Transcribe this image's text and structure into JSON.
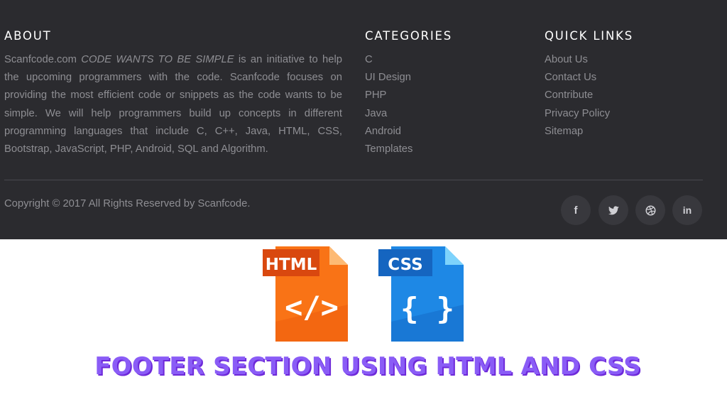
{
  "about": {
    "heading": "ABOUT",
    "text_prefix": "Scanfcode.com ",
    "text_emphasis": "CODE WANTS TO BE SIMPLE",
    "text_suffix": " is an initiative to help the upcoming programmers with the code. Scanfcode focuses on providing the most efficient code or snippets as the code wants to be simple. We will help programmers build up concepts in different programming languages that include C, C++, Java, HTML, CSS, Bootstrap, JavaScript, PHP, Android, SQL and Algorithm."
  },
  "categories": {
    "heading": "CATEGORIES",
    "items": [
      "C",
      "UI Design",
      "PHP",
      "Java",
      "Android",
      "Templates"
    ]
  },
  "quick_links": {
    "heading": "QUICK LINKS",
    "items": [
      "About Us",
      "Contact Us",
      "Contribute",
      "Privacy Policy",
      "Sitemap"
    ]
  },
  "copyright": "Copyright © 2017 All Rights Reserved by Scanfcode.",
  "social": {
    "facebook_glyph": "f",
    "twitter_icon": "twitter-icon",
    "dribbble_icon": "dribbble-icon",
    "linkedin_glyph": "in"
  },
  "banner": {
    "html_badge": "HTML",
    "html_symbol": "</>",
    "css_badge": "CSS",
    "css_symbol": "{ }",
    "title": "FOOTER SECTION USING HTML AND CSS"
  },
  "colors": {
    "footer_bg": "#2b2b2f",
    "heading": "#ffffff",
    "body_text": "#8e8e93",
    "social_bg": "#38383d",
    "html_orange": "#f97316",
    "css_blue": "#1e88e5",
    "title_purple": "#8a5cf6"
  }
}
